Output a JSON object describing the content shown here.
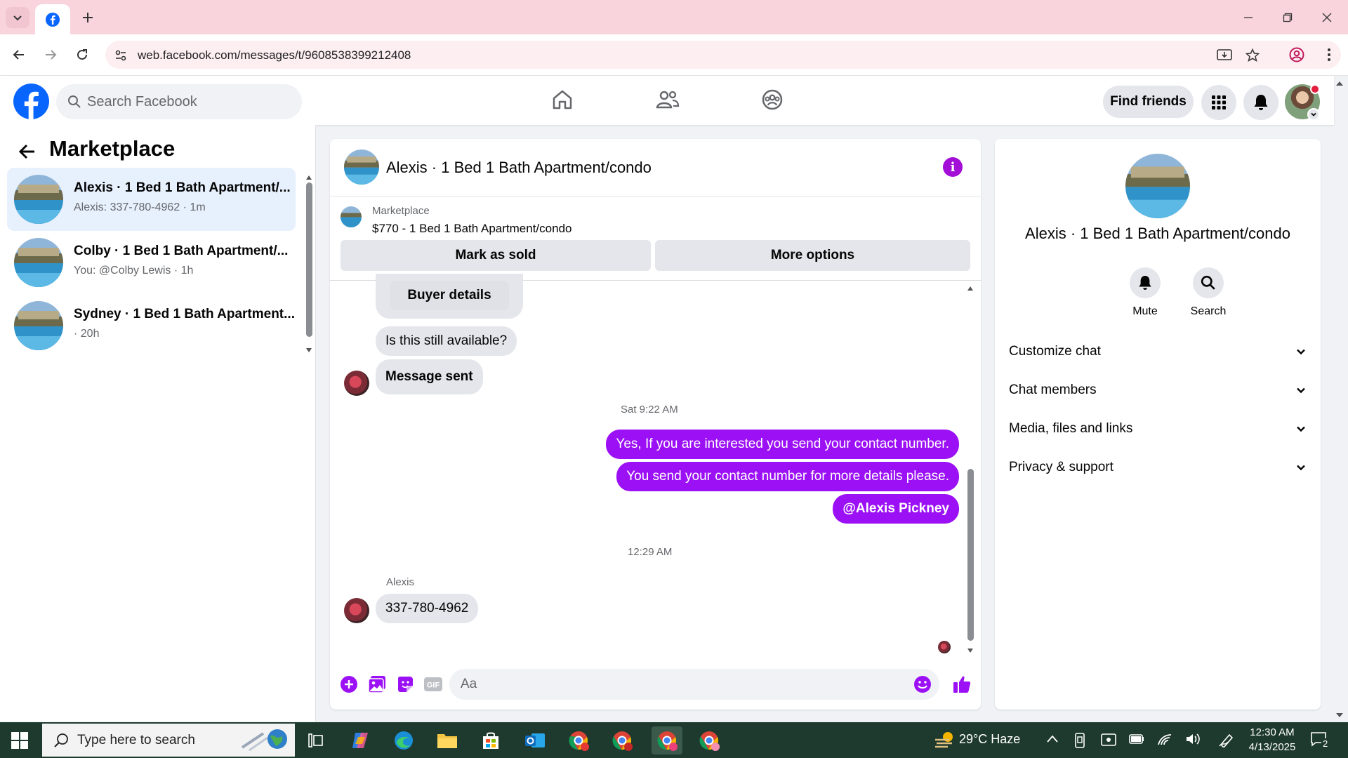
{
  "browser": {
    "url": "web.facebook.com/messages/t/9608538399212408"
  },
  "fb": {
    "search_placeholder": "Search Facebook",
    "find_friends": "Find friends"
  },
  "sidebar": {
    "title": "Marketplace",
    "conversations": [
      {
        "name": "Alexis · 1 Bed 1 Bath Apartment/...",
        "sub": "Alexis: 337-780-4962 · 1m",
        "active": true
      },
      {
        "name": "Colby · 1 Bed 1 Bath Apartment/...",
        "sub": "You: @Colby Lewis · 1h",
        "active": false
      },
      {
        "name": "Sydney · 1 Bed 1 Bath Apartment...",
        "sub": "· 20h",
        "active": false
      }
    ]
  },
  "chat": {
    "title": "Alexis · 1 Bed 1 Bath Apartment/condo",
    "listing_label": "Marketplace",
    "listing_price": "$770 - 1 Bed 1 Bath Apartment/condo",
    "mark_sold": "Mark as sold",
    "more_options": "More options",
    "messages": {
      "buyer_details": "Buyer details",
      "still_available": "Is this still available?",
      "message_sent": "Message sent",
      "ts1": "Sat 9:22 AM",
      "out1": "Yes, If you are interested you send your contact number.",
      "out2": "You send your contact number for more details please.",
      "out3": "@Alexis Pickney",
      "ts2": "12:29 AM",
      "sender": "Alexis",
      "phone": "337-780-4962"
    },
    "composer_placeholder": "Aa"
  },
  "details": {
    "name": "Alexis · 1 Bed 1 Bath Apartment/condo",
    "mute": "Mute",
    "search": "Search",
    "sections": [
      "Customize chat",
      "Chat members",
      "Media, files and links",
      "Privacy & support"
    ]
  },
  "taskbar": {
    "search_text": "Type here to search",
    "weather": "29°C  Haze",
    "time": "12:30 AM",
    "date": "4/13/2025",
    "notif_count": "2"
  },
  "colors": {
    "accent_purple": "#9b10f5",
    "fb_blue": "#0866ff",
    "tab_pink": "#f9d4dc"
  }
}
